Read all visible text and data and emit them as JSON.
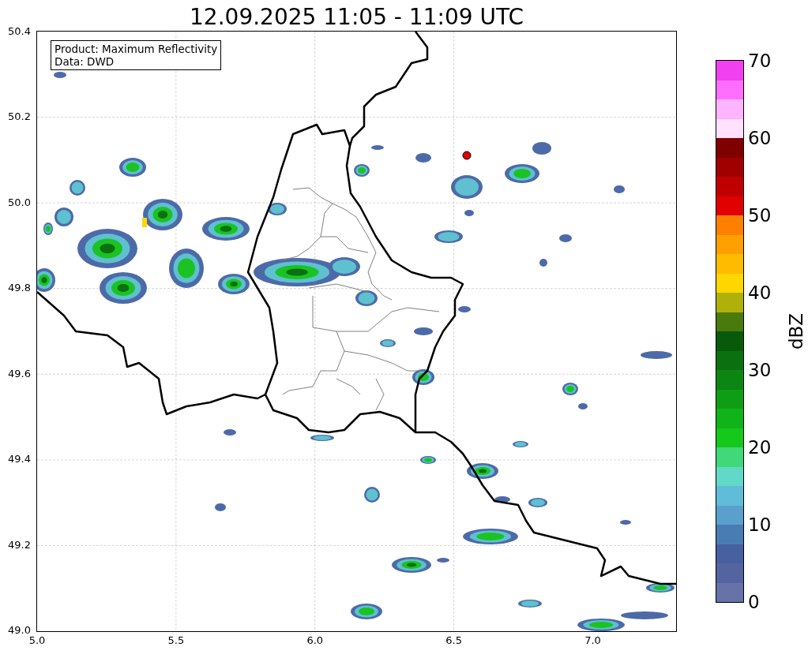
{
  "title": "12.09.2025 11:05 - 11:09 UTC",
  "info_box": {
    "lines": [
      "Product: Maximum Reflectivity",
      "Data: DWD"
    ]
  },
  "map": {
    "x_ticks": [
      "5.0",
      "5.5",
      "6.0",
      "6.5",
      "7.0"
    ],
    "y_ticks": [
      "50.4",
      "50.2",
      "50.0",
      "49.8",
      "49.6",
      "49.4",
      "49.2",
      "49.0"
    ]
  },
  "colorbar": {
    "label": "dBZ",
    "ticks": [
      "70",
      "60",
      "50",
      "40",
      "30",
      "20",
      "10",
      "0"
    ],
    "segments": [
      {
        "color": "#f040f0"
      },
      {
        "color": "#ff6eff"
      },
      {
        "color": "#ffb4ff"
      },
      {
        "color": "#ffe0ff"
      },
      {
        "color": "#800000"
      },
      {
        "color": "#a00000"
      },
      {
        "color": "#c00000"
      },
      {
        "color": "#e00000"
      },
      {
        "color": "#ff8000"
      },
      {
        "color": "#ff9f00"
      },
      {
        "color": "#ffbb00"
      },
      {
        "color": "#ffd700"
      },
      {
        "color": "#b0b00a"
      },
      {
        "color": "#4a7a0c"
      },
      {
        "color": "#085a0a"
      },
      {
        "color": "#0a7010"
      },
      {
        "color": "#0c8612"
      },
      {
        "color": "#0e9e16"
      },
      {
        "color": "#10b418"
      },
      {
        "color": "#14c81c"
      },
      {
        "color": "#40d878"
      },
      {
        "color": "#62d8c8"
      },
      {
        "color": "#60bcd8"
      },
      {
        "color": "#5aa0cc"
      },
      {
        "color": "#4a7cb4"
      },
      {
        "color": "#4760a0"
      },
      {
        "color": "#5464a0"
      },
      {
        "color": "#6672a8"
      }
    ]
  }
}
